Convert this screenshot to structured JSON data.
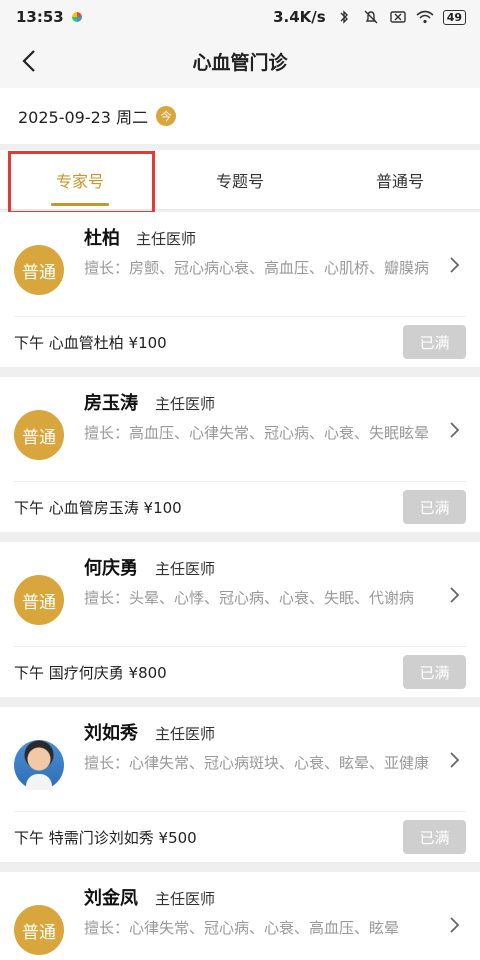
{
  "status_bar": {
    "time": "13:53",
    "speed": "3.4K/s",
    "battery": "49"
  },
  "header": {
    "title": "心血管门诊"
  },
  "date": {
    "text": "2025-09-23 周二",
    "today_badge": "今"
  },
  "tabs": [
    {
      "label": "专家号",
      "active": true
    },
    {
      "label": "专题号",
      "active": false
    },
    {
      "label": "普通号",
      "active": false
    }
  ],
  "doctors": [
    {
      "avatar_text": "普通",
      "name": "杜柏",
      "title": "主任医师",
      "specialty": "擅长：房颤、冠心病心衰、高血压、心肌桥、瓣膜病",
      "slot": "下午  心血管杜柏  ¥100",
      "status": "已满"
    },
    {
      "avatar_text": "普通",
      "name": "房玉涛",
      "title": "主任医师",
      "specialty": "擅长：高血压、心律失常、冠心病、心衰、失眠眩晕",
      "slot": "下午  心血管房玉涛  ¥100",
      "status": "已满"
    },
    {
      "avatar_text": "普通",
      "name": "何庆勇",
      "title": "主任医师",
      "specialty": "擅长：头晕、心悸、冠心病、心衰、失眠、代谢病",
      "slot": "下午  国疗何庆勇  ¥800",
      "status": "已满"
    },
    {
      "avatar_text": "",
      "name": "刘如秀",
      "title": "主任医师",
      "specialty": "擅长：心律失常、冠心病斑块、心衰、眩晕、亚健康",
      "slot": "下午  特需门诊刘如秀  ¥500",
      "status": "已满"
    },
    {
      "avatar_text": "普通",
      "name": "刘金凤",
      "title": "主任医师",
      "specialty": "擅长：心律失常、冠心病、心衰、高血压、眩晕",
      "slot": "",
      "status": ""
    }
  ],
  "colors": {
    "accent": "#c8962e",
    "avatar_bg": "#d9a53d",
    "full_btn": "#cfcfcf",
    "highlight": "#e53935"
  }
}
